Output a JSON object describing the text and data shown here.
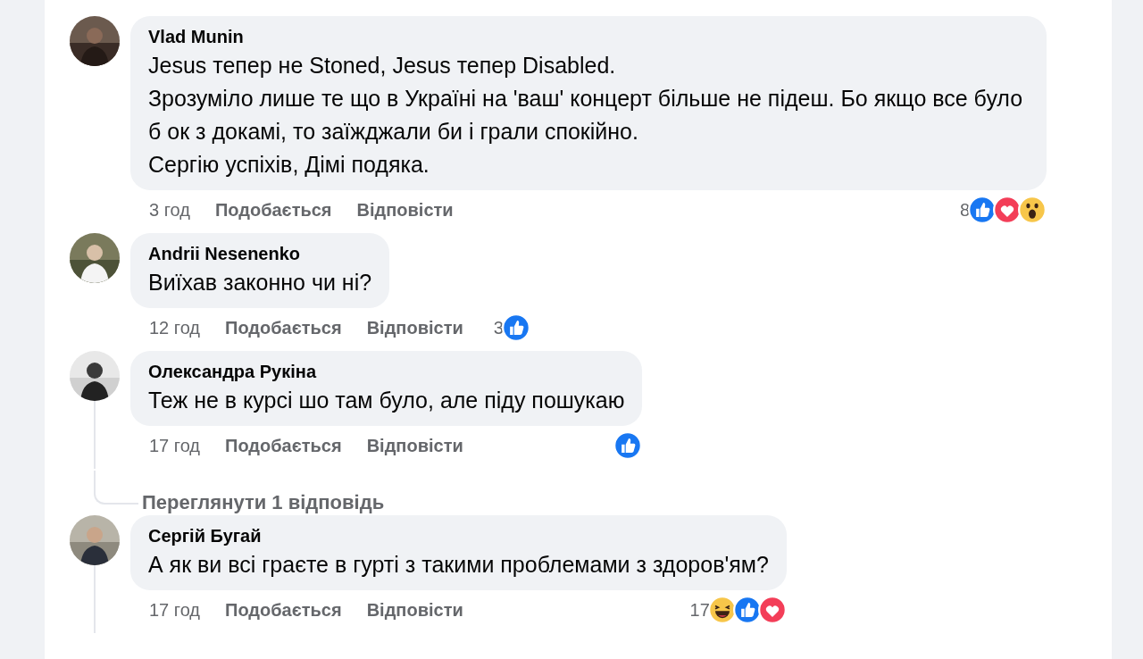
{
  "comments": [
    {
      "author": "Vlad Munin",
      "paragraphs": [
        "Jesus тепер не Stoned, Jesus тепер Disabled.",
        "Зрозуміло лише те що в Україні на 'ваш' концерт більше не підеш. Бо якщо все було б ок з докамі, то заїжджали би і грали спокійно.",
        "Сергію успіхів, Дімі подяка."
      ],
      "time": "3 год",
      "like": "Подобається",
      "reply": "Відповісти",
      "reaction_count": "8",
      "reactions": [
        {
          "kind": "like"
        },
        {
          "kind": "love"
        },
        {
          "kind": "wow"
        }
      ],
      "thread_line": false
    },
    {
      "author": "Andrii Nesenenko",
      "paragraphs": [
        "Виїхав законно чи ні?"
      ],
      "time": "12 год",
      "like": "Подобається",
      "reply": "Відповісти",
      "reaction_count": "3",
      "reactions": [
        {
          "kind": "like"
        }
      ],
      "thread_line": false
    },
    {
      "author": "Олександра Рукіна",
      "paragraphs": [
        "Теж не в курсі шо там було, але піду пошукаю"
      ],
      "time": "17 год",
      "like": "Подобається",
      "reply": "Відповісти",
      "reactions": [
        {
          "kind": "like"
        }
      ],
      "thread_line": true,
      "replies_link": "Переглянути 1 відповідь"
    },
    {
      "author": "Сергій Бугай",
      "paragraphs": [
        "А як ви всі граєте в гурті з такими проблемами з здоров'ям?"
      ],
      "time": "17 год",
      "like": "Подобається",
      "reply": "Відповісти",
      "reaction_count": "17",
      "reactions": [
        {
          "kind": "haha"
        },
        {
          "kind": "like"
        },
        {
          "kind": "love"
        }
      ],
      "thread_line": true
    }
  ]
}
